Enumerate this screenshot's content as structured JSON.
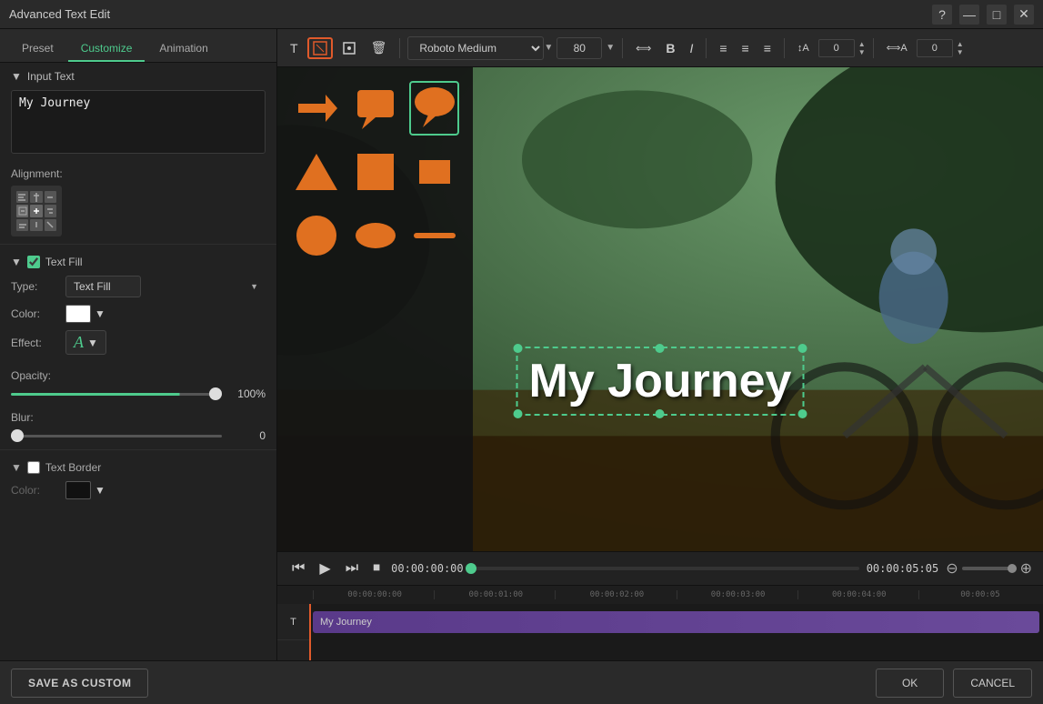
{
  "titleBar": {
    "title": "Advanced Text Edit",
    "helpBtn": "?",
    "minimizeBtn": "—",
    "maximizeBtn": "□",
    "closeBtn": "✕"
  },
  "tabs": {
    "preset": "Preset",
    "customize": "Customize",
    "animation": "Animation",
    "activeTab": "customize"
  },
  "leftPanel": {
    "inputText": {
      "header": "Input Text",
      "value": "My Journey"
    },
    "alignment": {
      "label": "Alignment:"
    },
    "textFill": {
      "header": "Text Fill",
      "enabled": true,
      "typeLabel": "Type:",
      "typeValue": "Text Fill",
      "colorLabel": "Color:",
      "effectLabel": "Effect:",
      "effectLetter": "A"
    },
    "opacity": {
      "label": "Opacity:",
      "value": 100,
      "display": "100%"
    },
    "blur": {
      "label": "Blur:",
      "value": 0,
      "display": "0"
    },
    "textBorder": {
      "header": "Text Border",
      "enabled": false,
      "colorLabel": "Color:"
    }
  },
  "toolbar": {
    "fontName": "Roboto Medium",
    "fontSize": "80",
    "boldLabel": "B",
    "italicLabel": "I",
    "alignLeft": "≡",
    "alignCenter": "≡",
    "alignRight": "≡",
    "spacingValue": "0",
    "offsetValue": "0"
  },
  "canvas": {
    "textOverlay": "My Journey"
  },
  "timeline": {
    "currentTime": "00:00:00:00",
    "totalTime": "00:00:05:05",
    "trackLabel": "T",
    "trackText": "My Journey",
    "rulers": [
      "00:00:00:00",
      "00:00:01:00",
      "00:00:02:00",
      "00:00:03:00",
      "00:00:04:00",
      "00:00:05"
    ]
  },
  "bottomBar": {
    "saveAsCustom": "SAVE AS CUSTOM",
    "ok": "OK",
    "cancel": "CANCEL"
  },
  "shapes": [
    {
      "id": "arrow",
      "type": "arrow"
    },
    {
      "id": "speech-rect",
      "type": "speech-rect"
    },
    {
      "id": "speech-round",
      "type": "speech-round",
      "selected": true
    },
    {
      "id": "triangle",
      "type": "triangle"
    },
    {
      "id": "rect",
      "type": "rect"
    },
    {
      "id": "small-rect",
      "type": "small-rect"
    },
    {
      "id": "circle",
      "type": "circle"
    },
    {
      "id": "oval",
      "type": "oval"
    },
    {
      "id": "line",
      "type": "line"
    }
  ]
}
